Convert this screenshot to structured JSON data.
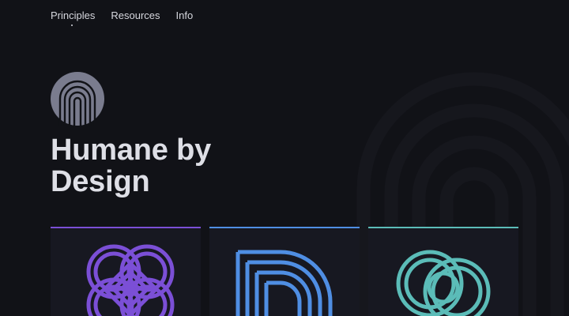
{
  "nav": {
    "items": [
      {
        "label": "Principles",
        "active": true
      },
      {
        "label": "Resources",
        "active": false
      },
      {
        "label": "Info",
        "active": false
      }
    ]
  },
  "hero": {
    "title": "Humane by Design",
    "logo_icon": "fingerprint-arch-icon"
  },
  "cards": [
    {
      "icon": "interlocked-loop-icon",
      "accent": "#7b4fd6"
    },
    {
      "icon": "striped-d-shape-icon",
      "accent": "#4f8ee3"
    },
    {
      "icon": "interlinked-rings-icon",
      "accent": "#5bbcb8"
    }
  ],
  "colors": {
    "background": "#111217",
    "card_background": "#171821",
    "text": "#dedfe6",
    "logo": "#7a7c8e"
  }
}
